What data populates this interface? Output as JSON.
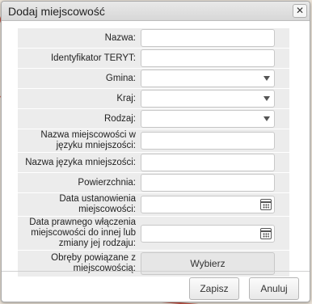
{
  "dialog": {
    "title": "Dodaj miejscowość",
    "close_symbol": "✕"
  },
  "form": {
    "nazwa": {
      "label": "Nazwa:",
      "value": ""
    },
    "teryt": {
      "label": "Identyfikator TERYT:",
      "value": ""
    },
    "gmina": {
      "label": "Gmina:",
      "selected": ""
    },
    "kraj": {
      "label": "Kraj:",
      "selected": ""
    },
    "rodzaj": {
      "label": "Rodzaj:",
      "selected": ""
    },
    "nazwa_mniejszosci": {
      "label": "Nazwa miejscowości w języku mniejszości:",
      "value": ""
    },
    "nazwa_jezyka": {
      "label": "Nazwa języka mniejszości:",
      "value": ""
    },
    "powierzchnia": {
      "label": "Powierzchnia:",
      "value": ""
    },
    "data_ustanowienia": {
      "label": "Data ustanowienia miejscowości:",
      "value": ""
    },
    "data_wlaczenia": {
      "label": "Data prawnego włączenia miejscowości do innej lub zmiany jej rodzaju:",
      "value": ""
    },
    "obreby": {
      "label": "Obręby powiązane z miejscowością:",
      "button": "Wybierz"
    }
  },
  "footer": {
    "save_label": "Zapisz",
    "cancel_label": "Anuluj"
  },
  "icons": {
    "dropdown": "chevron-down-icon",
    "date": "calendar-icon",
    "close": "close-icon"
  },
  "colors": {
    "titlebar": "#dcdcdc",
    "form_background": "#ececec",
    "map_lines": "#c0392b"
  }
}
